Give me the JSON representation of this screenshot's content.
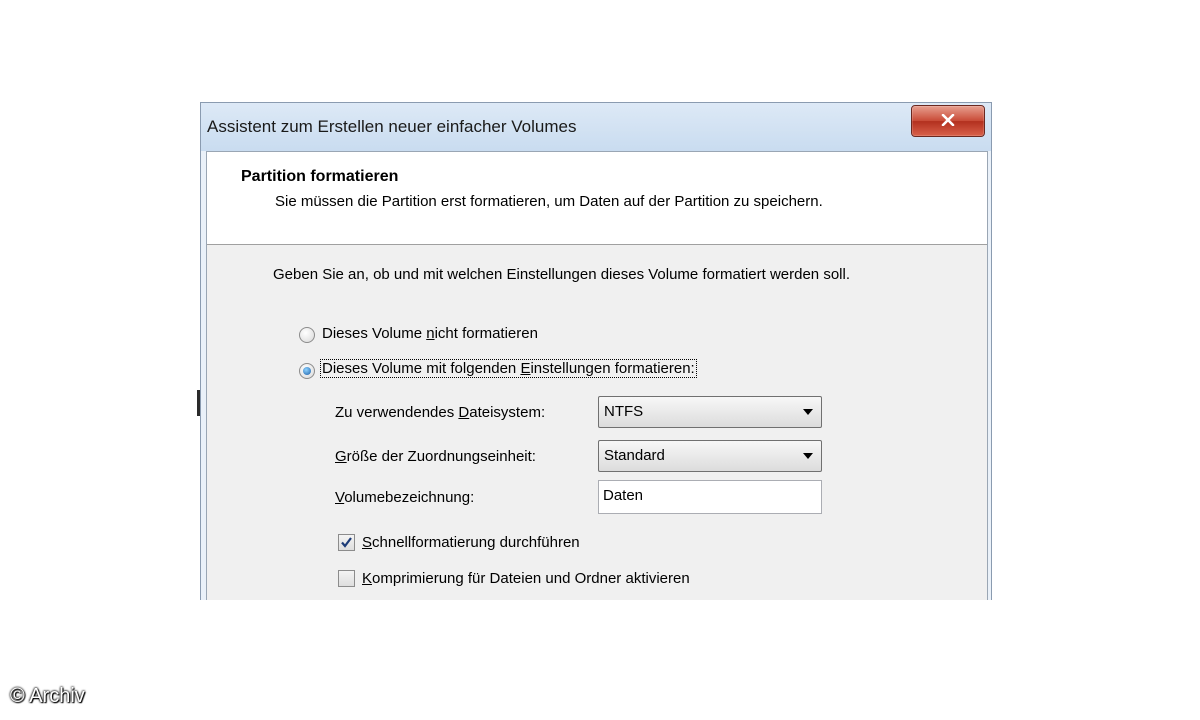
{
  "window": {
    "title": "Assistent zum Erstellen neuer einfacher Volumes"
  },
  "header": {
    "title": "Partition formatieren",
    "subtitle": "Sie müssen die Partition erst formatieren, um Daten auf der Partition zu speichern."
  },
  "instructions": "Geben Sie an, ob und mit welchen Einstellungen dieses Volume formatiert werden soll.",
  "options": {
    "no_format": {
      "label_pre": "Dieses Volume ",
      "label_accel": "n",
      "label_post": "icht formatieren",
      "selected": false
    },
    "format": {
      "label_pre": "Dieses Volume mit folgenden ",
      "label_accel": "E",
      "label_post": "instellungen formatieren:",
      "selected": true
    }
  },
  "settings": {
    "filesystem": {
      "label_pre": "Zu verwendendes ",
      "label_accel": "D",
      "label_post": "ateisystem:",
      "value": "NTFS"
    },
    "allocation": {
      "label_pre": "",
      "label_accel": "G",
      "label_post": "röße der Zuordnungseinheit:",
      "value": "Standard"
    },
    "volume_label": {
      "label_pre": "",
      "label_accel": "V",
      "label_post": "olumebezeichnung:",
      "value": "Daten"
    }
  },
  "checkboxes": {
    "quick_format": {
      "label_pre": "",
      "label_accel": "S",
      "label_post": "chnellformatierung durchführen",
      "checked": true
    },
    "compression": {
      "label_pre": "",
      "label_accel": "K",
      "label_post": "omprimierung für Dateien und Ordner aktivieren",
      "checked": false
    }
  },
  "copyright": "© Archiv",
  "icons": {
    "close": "close-icon",
    "check": "checkmark-icon",
    "dropdown": "chevron-down-icon"
  }
}
